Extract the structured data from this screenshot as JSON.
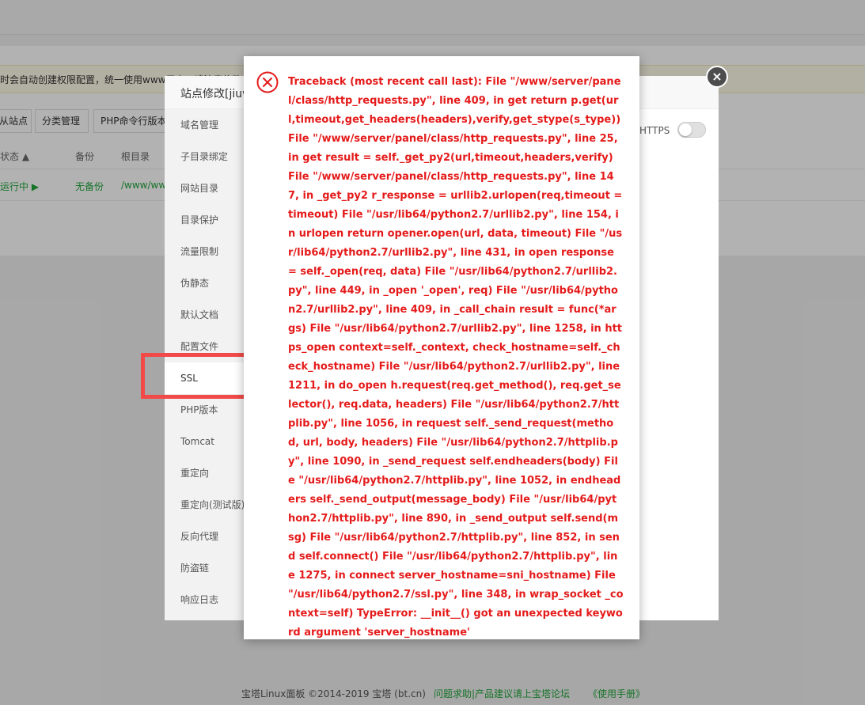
{
  "background": {
    "notice_text": "时会自动创建权限配置，统一使用www用户，请注意修改",
    "buttons": [
      "从站点",
      "分类管理",
      "PHP命令行版本"
    ],
    "table_headers": [
      "状态 ▲",
      "备份",
      "根目录"
    ],
    "table_row": {
      "status": "运行中 ▶",
      "backup": "无备份",
      "root": "/www/wwwroot"
    }
  },
  "site_dialog": {
    "title": "站点修改[jiuwu",
    "https_label": "HTTPS",
    "close_symbol": "×",
    "nav_items": [
      "域名管理",
      "子目录绑定",
      "网站目录",
      "目录保护",
      "流量限制",
      "伪静态",
      "默认文档",
      "配置文件",
      "SSL",
      "PHP版本",
      "Tomcat",
      "重定向",
      "重定向(测试版)",
      "反向代理",
      "防盗链",
      "响应日志"
    ],
    "active_item": "SSL"
  },
  "error_dialog": {
    "icon": "error-circle-x-icon",
    "message": "Traceback (most recent call last): File \"/www/server/panel/class/http_requests.py\", line 409, in get return p.get(url,timeout,get_headers(headers),verify,get_stype(s_type)) File \"/www/server/panel/class/http_requests.py\", line 25, in get result = self._get_py2(url,timeout,headers,verify) File \"/www/server/panel/class/http_requests.py\", line 147, in _get_py2 r_response = urllib2.urlopen(req,timeout = timeout) File \"/usr/lib64/python2.7/urllib2.py\", line 154, in urlopen return opener.open(url, data, timeout) File \"/usr/lib64/python2.7/urllib2.py\", line 431, in open response = self._open(req, data) File \"/usr/lib64/python2.7/urllib2.py\", line 449, in _open '_open', req) File \"/usr/lib64/python2.7/urllib2.py\", line 409, in _call_chain result = func(*args) File \"/usr/lib64/python2.7/urllib2.py\", line 1258, in https_open context=self._context, check_hostname=self._check_hostname) File \"/usr/lib64/python2.7/urllib2.py\", line 1211, in do_open h.request(req.get_method(), req.get_selector(), req.data, headers) File \"/usr/lib64/python2.7/httplib.py\", line 1056, in request self._send_request(method, url, body, headers) File \"/usr/lib64/python2.7/httplib.py\", line 1090, in _send_request self.endheaders(body) File \"/usr/lib64/python2.7/httplib.py\", line 1052, in endheaders self._send_output(message_body) File \"/usr/lib64/python2.7/httplib.py\", line 890, in _send_output self.send(msg) File \"/usr/lib64/python2.7/httplib.py\", line 852, in send self.connect() File \"/usr/lib64/python2.7/httplib.py\", line 1275, in connect server_hostname=sni_hostname) File \"/usr/lib64/python2.7/ssl.py\", line 348, in wrap_socket _context=self) TypeError: __init__() got an unexpected keyword argument 'server_hostname'"
  },
  "footer": {
    "copyright": "宝塔Linux面板 ©2014-2019 宝塔 (bt.cn)",
    "help_link": "问题求助|产品建议请上宝塔论坛",
    "manual_link": "《使用手册》"
  },
  "colors": {
    "error_red": "#e51b1b",
    "highlight_red": "#f24a48",
    "running_green": "#20a53a"
  }
}
